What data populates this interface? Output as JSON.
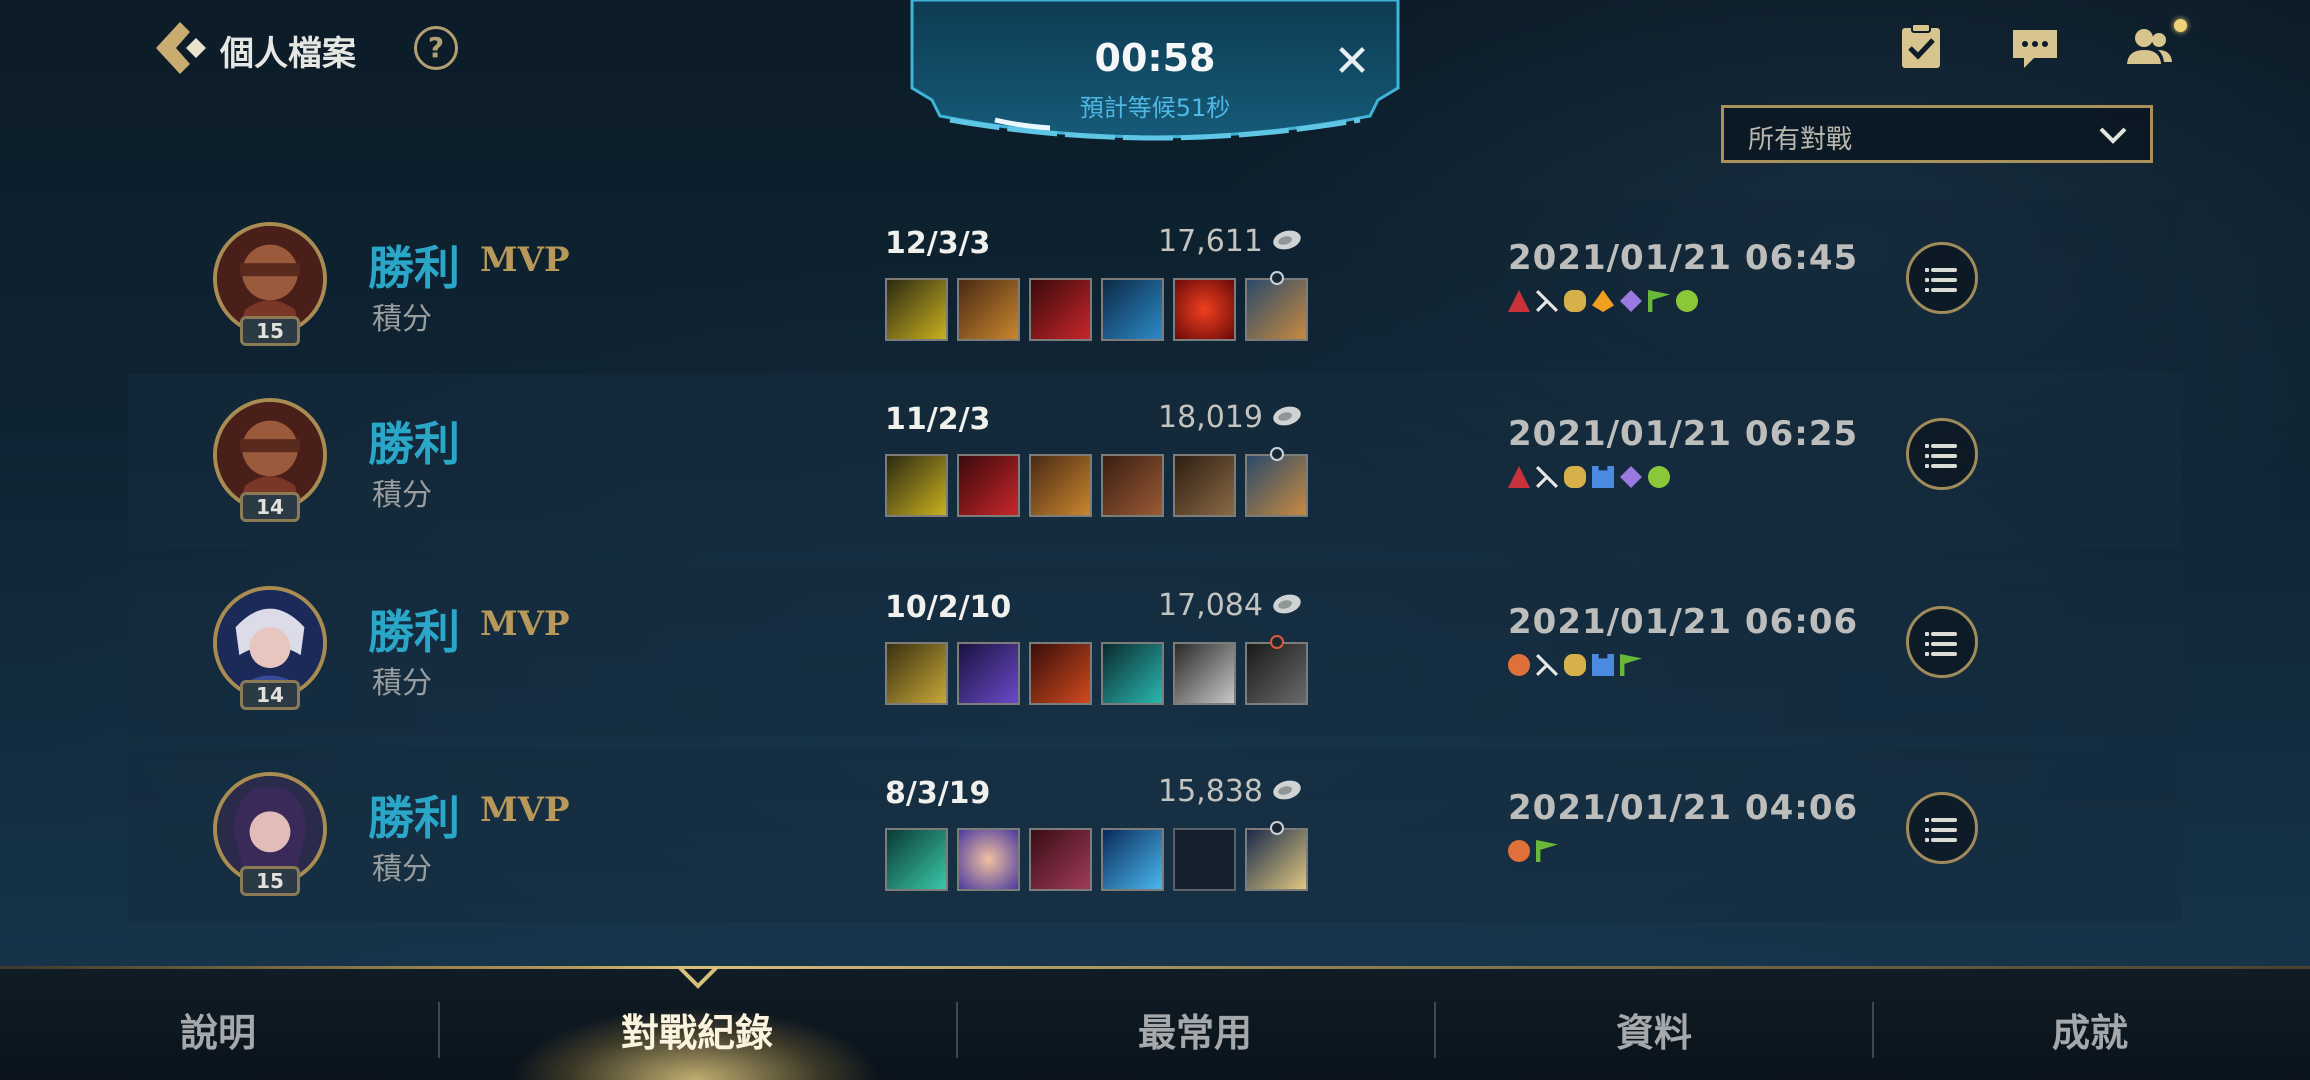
{
  "header": {
    "title": "個人檔案",
    "help_label": "?",
    "filter_value": "所有對戰"
  },
  "queue": {
    "timer": "00:58",
    "estimated_wait": "預計等候51秒",
    "close_label": "✕"
  },
  "matches": [
    {
      "hero_level": "15",
      "result": "勝利",
      "mvp": "MVP",
      "mode": "積分",
      "kda": "12/3/3",
      "gold": "17,611",
      "date": "2021/01/21 06:45"
    },
    {
      "hero_level": "14",
      "result": "勝利",
      "mvp": "",
      "mode": "積分",
      "kda": "11/2/3",
      "gold": "18,019",
      "date": "2021/01/21 06:25"
    },
    {
      "hero_level": "14",
      "result": "勝利",
      "mvp": "MVP",
      "mode": "積分",
      "kda": "10/2/10",
      "gold": "17,084",
      "date": "2021/01/21 06:06"
    },
    {
      "hero_level": "15",
      "result": "勝利",
      "mvp": "MVP",
      "mode": "積分",
      "kda": "8/3/19",
      "gold": "15,838",
      "date": "2021/01/21 04:06"
    }
  ],
  "nav": {
    "tabs": [
      {
        "label": "說明"
      },
      {
        "label": "對戰紀錄",
        "active": true
      },
      {
        "label": "最常用"
      },
      {
        "label": "資料"
      },
      {
        "label": "成就"
      }
    ]
  },
  "colors": {
    "accent_gold": "#b8995a",
    "victory_blue": "#2aa6c8",
    "timer_blue": "#4fb8e4"
  }
}
